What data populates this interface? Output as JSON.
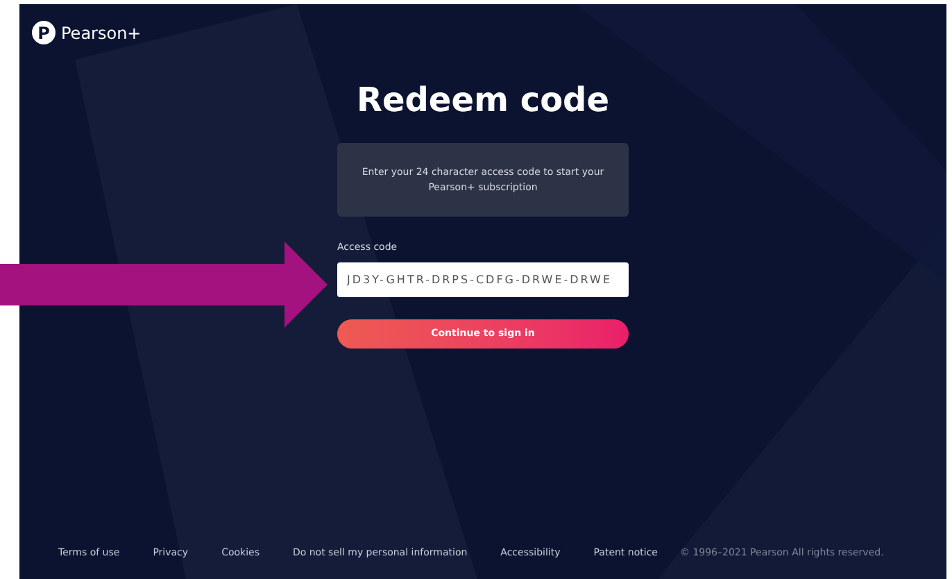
{
  "brand": {
    "name": "Pearson+",
    "logo_letter": "P"
  },
  "title": "Redeem code",
  "info": "Enter your 24 character access code to start your Pearson+ subscription",
  "field": {
    "label": "Access code",
    "value": "JD3Y-GHTR-DRPS-CDFG-DRWE-DRWE"
  },
  "button": "Continue to sign in",
  "footer": {
    "links": [
      "Terms of use",
      "Privacy",
      "Cookies",
      "Do not sell my personal information",
      "Accessibility",
      "Patent notice"
    ],
    "copyright": "© 1996–2021 Pearson All rights reserved."
  }
}
